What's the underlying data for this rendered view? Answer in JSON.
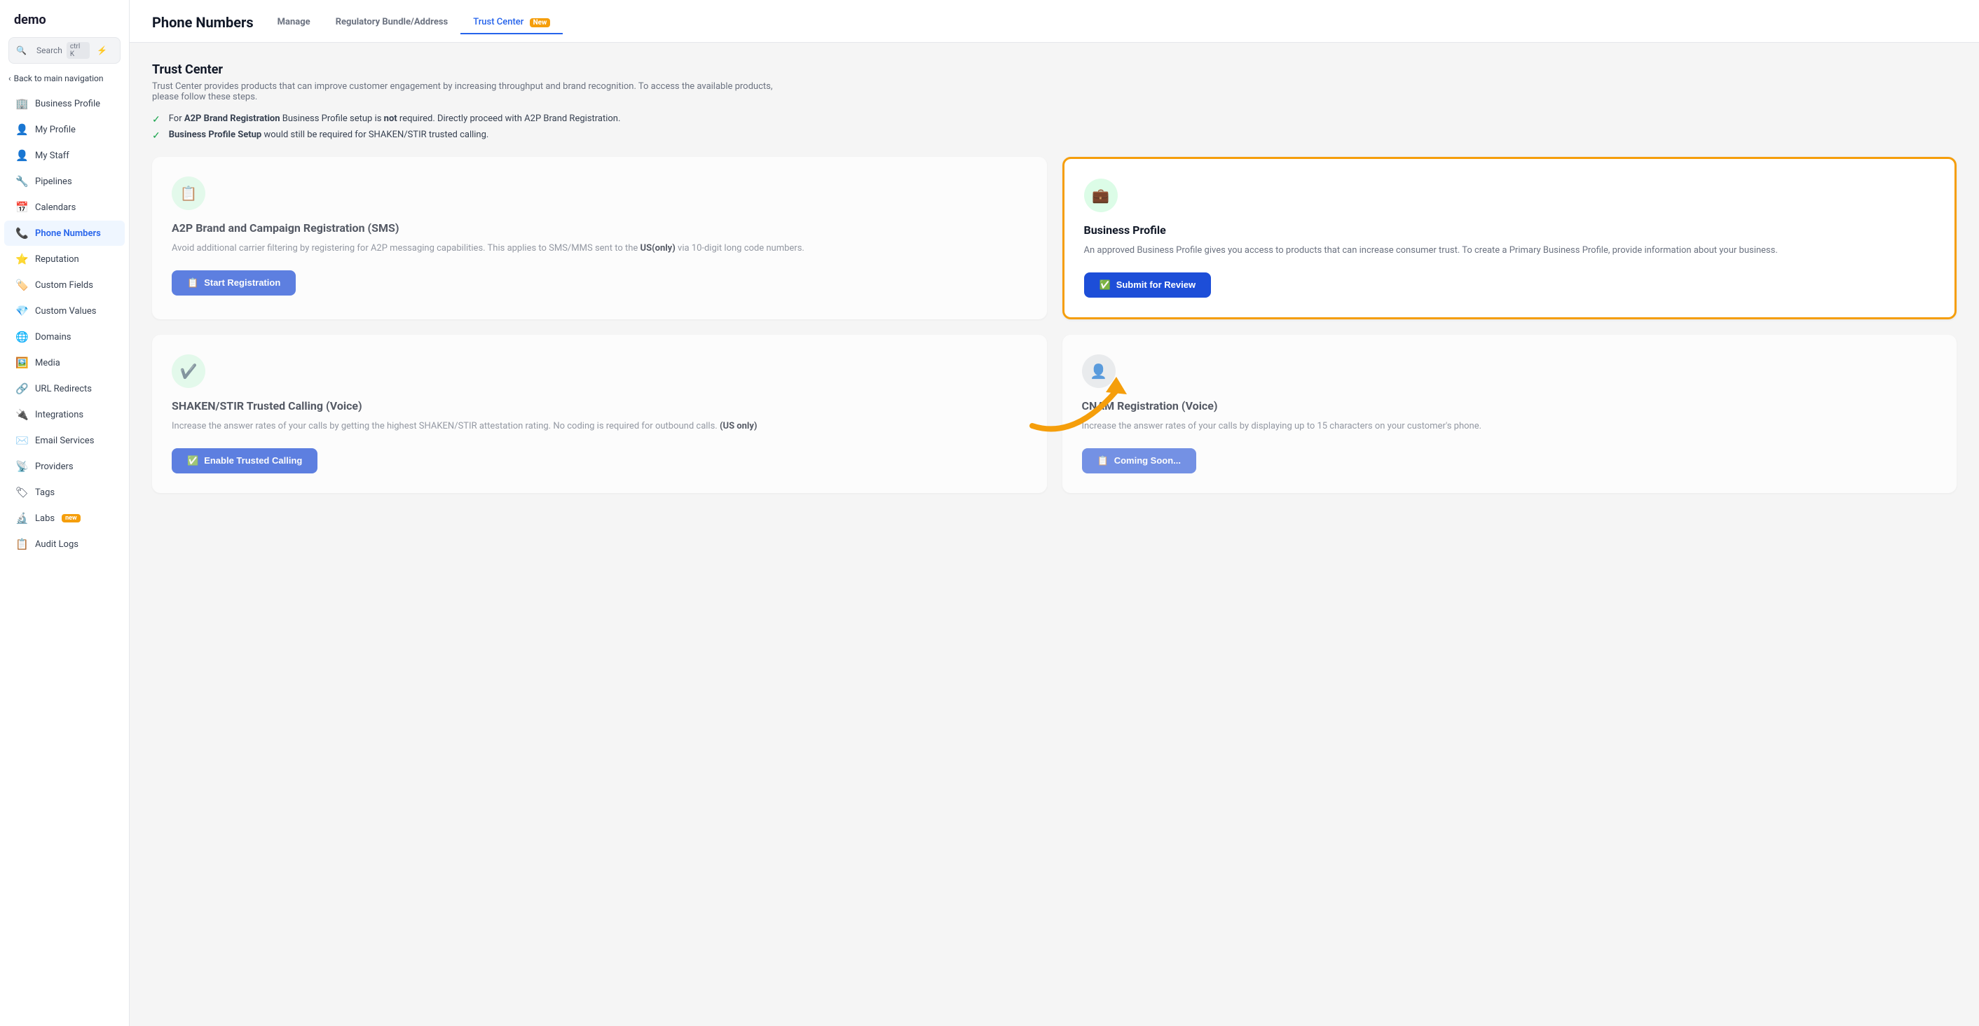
{
  "app": {
    "logo": "demo",
    "search_placeholder": "Search",
    "search_shortcut": "ctrl K"
  },
  "sidebar": {
    "back_label": "Back to main navigation",
    "items": [
      {
        "id": "business-profile",
        "label": "Business Profile",
        "icon": "🏢",
        "active": false
      },
      {
        "id": "my-profile",
        "label": "My Profile",
        "icon": "👤",
        "active": false
      },
      {
        "id": "my-staff",
        "label": "My Staff",
        "icon": "👤",
        "active": false
      },
      {
        "id": "pipelines",
        "label": "Pipelines",
        "icon": "🔧",
        "active": false
      },
      {
        "id": "calendars",
        "label": "Calendars",
        "icon": "📅",
        "active": false
      },
      {
        "id": "phone-numbers",
        "label": "Phone Numbers",
        "icon": "📞",
        "active": true
      },
      {
        "id": "reputation",
        "label": "Reputation",
        "icon": "⭐",
        "active": false
      },
      {
        "id": "custom-fields",
        "label": "Custom Fields",
        "icon": "🏷️",
        "active": false
      },
      {
        "id": "custom-values",
        "label": "Custom Values",
        "icon": "💎",
        "active": false
      },
      {
        "id": "domains",
        "label": "Domains",
        "icon": "🌐",
        "active": false
      },
      {
        "id": "media",
        "label": "Media",
        "icon": "🖼️",
        "active": false
      },
      {
        "id": "url-redirects",
        "label": "URL Redirects",
        "icon": "🔗",
        "active": false
      },
      {
        "id": "integrations",
        "label": "Integrations",
        "icon": "🔌",
        "active": false
      },
      {
        "id": "email-services",
        "label": "Email Services",
        "icon": "✉️",
        "active": false
      },
      {
        "id": "providers",
        "label": "Providers",
        "icon": "📡",
        "active": false
      },
      {
        "id": "tags",
        "label": "Tags",
        "icon": "🏷",
        "active": false
      },
      {
        "id": "labs",
        "label": "Labs",
        "icon": "🔬",
        "active": false,
        "badge": "new"
      },
      {
        "id": "audit-logs",
        "label": "Audit Logs",
        "icon": "📋",
        "active": false
      }
    ]
  },
  "header": {
    "title": "Phone Numbers",
    "tabs": [
      {
        "id": "manage",
        "label": "Manage",
        "active": false
      },
      {
        "id": "regulatory",
        "label": "Regulatory Bundle/Address",
        "active": false
      },
      {
        "id": "trust-center",
        "label": "Trust Center",
        "active": true,
        "badge": "New"
      }
    ]
  },
  "trust_center": {
    "title": "Trust Center",
    "description": "Trust Center provides products that can improve customer engagement by increasing throughput and brand recognition. To access the available products, please follow these steps.",
    "bullets": [
      {
        "text_parts": [
          {
            "type": "normal",
            "text": "For "
          },
          {
            "type": "bold",
            "text": "A2P Brand Registration"
          },
          {
            "type": "normal",
            "text": " Business Profile setup is "
          },
          {
            "type": "bold",
            "text": "not"
          },
          {
            "type": "normal",
            "text": " required. Directly proceed with A2P Brand Registration."
          }
        ]
      },
      {
        "text_parts": [
          {
            "type": "bold",
            "text": "Business Profile Setup"
          },
          {
            "type": "normal",
            "text": " would still be required for SHAKEN/STIR trusted calling."
          }
        ]
      }
    ],
    "cards": [
      {
        "id": "a2p",
        "title": "A2P Brand and Campaign Registration (SMS)",
        "description": "Avoid additional carrier filtering by registering for A2P messaging capabilities. This applies to SMS/MMS sent to the US(only) via 10-digit long code numbers.",
        "us_only": true,
        "button_label": "Start Registration",
        "button_icon": "📋",
        "highlighted": false,
        "dimmed": true
      },
      {
        "id": "business-profile",
        "title": "Business Profile",
        "description": "An approved Business Profile gives you access to products that can increase consumer trust. To create a Primary Business Profile, provide information about your business.",
        "button_label": "Submit for Review",
        "button_icon": "✅",
        "highlighted": true,
        "dimmed": false
      },
      {
        "id": "shaken-stir",
        "title": "SHAKEN/STIR Trusted Calling (Voice)",
        "description": "Increase the answer rates of your calls by getting the highest SHAKEN/STIR attestation rating. No coding is required for outbound calls. (US only)",
        "button_label": "Enable Trusted Calling",
        "button_icon": "✅",
        "highlighted": false,
        "dimmed": true
      },
      {
        "id": "cnam",
        "title": "CNAM Registration (Voice)",
        "description": "Increase the answer rates of your calls by displaying up to 15 characters on your customer's phone.",
        "button_label": "Coming Soon...",
        "button_icon": "📋",
        "highlighted": false,
        "dimmed": true
      }
    ]
  }
}
